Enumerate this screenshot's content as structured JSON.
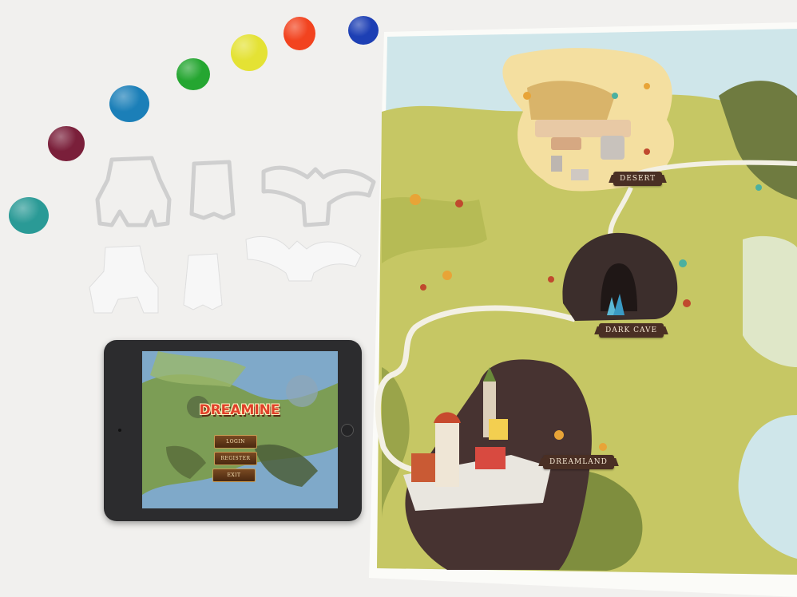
{
  "map": {
    "locations": [
      {
        "label": "DESERT"
      },
      {
        "label": "DARK CAVE"
      },
      {
        "label": "DREAMLAND"
      }
    ]
  },
  "game": {
    "title": "DREAMINE",
    "menu": [
      {
        "label": "LOGIN"
      },
      {
        "label": "REGISTER"
      },
      {
        "label": "EXIT"
      }
    ]
  },
  "colors": {
    "table": "#f1f0ee",
    "map_green": "#c6c764",
    "map_water": "#cfe6ea",
    "cave": "#3c2e2c",
    "dough": [
      "#2a9a96",
      "#7a1f3a",
      "#1b7fb8",
      "#25a631",
      "#e4e234",
      "#f2431f",
      "#1d3fb4"
    ]
  },
  "icons": [
    "play-dough-ball",
    "cookie-cutter",
    "clay-figure",
    "tablet-home-button"
  ]
}
